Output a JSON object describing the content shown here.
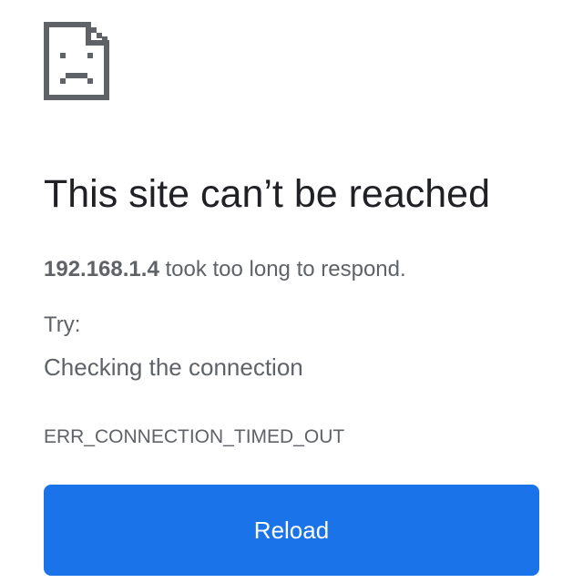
{
  "error_page": {
    "icon": "sad-document-icon",
    "title": "This site can’t be reached",
    "host": "192.168.1.4",
    "summary_suffix": " took too long to respond.",
    "try_label": "Try:",
    "suggestions": [
      "Checking the connection"
    ],
    "error_code": "ERR_CONNECTION_TIMED_OUT",
    "reload_label": "Reload"
  },
  "colors": {
    "accent": "#1a73e8",
    "title_text": "#202124",
    "body_text": "#5f6368",
    "icon": "#5f6368"
  }
}
